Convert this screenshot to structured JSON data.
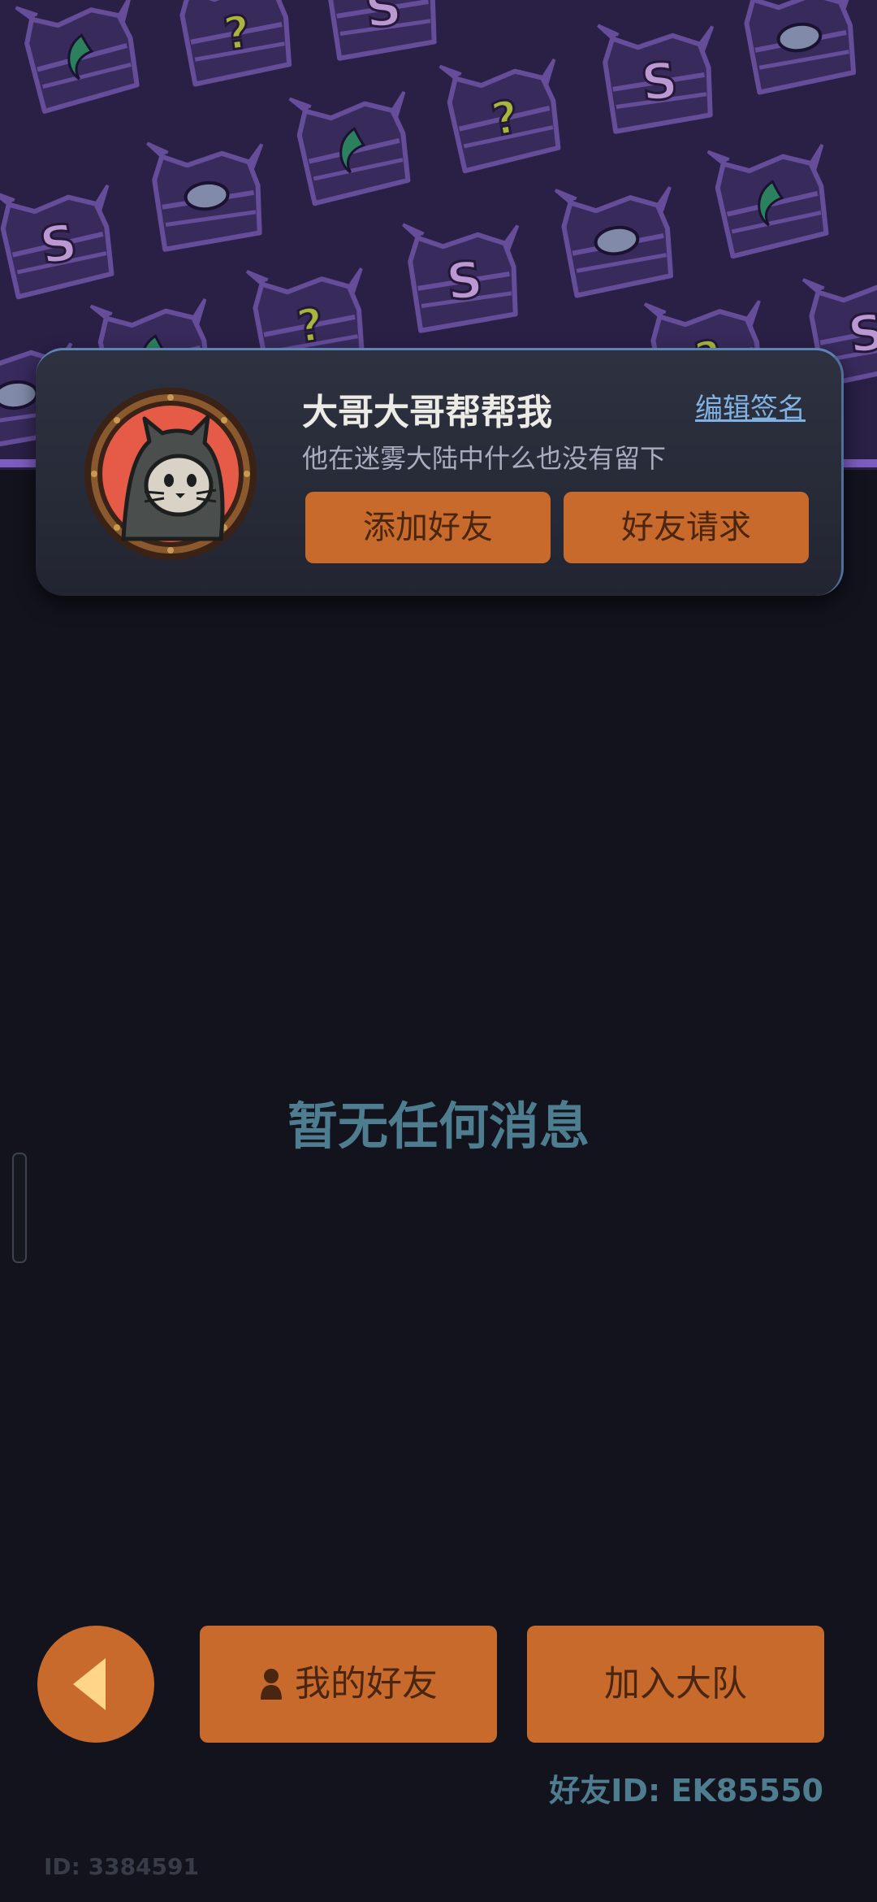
{
  "profile": {
    "username": "大哥大哥帮帮我",
    "edit_signature_label": "编辑签名",
    "signature": "他在迷雾大陆中什么也没有留下",
    "add_friend_label": "添加好友",
    "friend_request_label": "好友请求",
    "avatar_icon": "hooded-cat-avatar-icon"
  },
  "main": {
    "empty_message": "暂无任何消息"
  },
  "bottom_bar": {
    "back_icon": "back-arrow-icon",
    "my_friends_label": "我的好友",
    "my_friends_icon": "person-icon",
    "join_team_label": "加入大队"
  },
  "footer": {
    "friend_id_text": "好友ID: EK85550",
    "user_id_text": "ID: 3384591"
  },
  "colors": {
    "accent_orange": "#c86a2b",
    "button_text": "#4a2510",
    "background": "#12131c",
    "muted_teal": "#4e7d8f",
    "banner_purple": "#2a1f45",
    "link_blue": "#7fb2e2"
  }
}
